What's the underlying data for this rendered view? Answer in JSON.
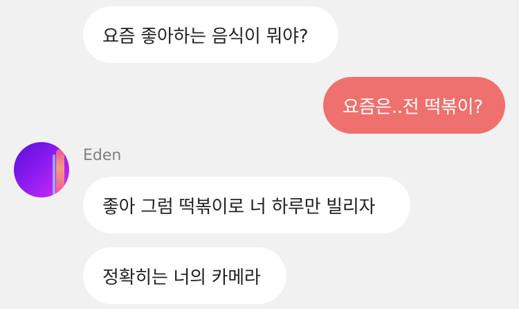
{
  "messages": [
    {
      "direction": "incoming",
      "text": "요즘 좋아하는 음식이 뭐야?"
    },
    {
      "direction": "outgoing",
      "text": "요즘은..전 떡볶이?"
    },
    {
      "direction": "incoming",
      "text": "좋아 그럼 떡볶이로 너 하루만 빌리자"
    },
    {
      "direction": "incoming",
      "text": "정확히는 너의 카메라"
    }
  ],
  "contact": {
    "name": "Eden",
    "avatar_icon": "profile-photo"
  },
  "colors": {
    "background": "#f1f1f1",
    "incoming_bubble": "#ffffff",
    "outgoing_bubble": "#ef716e",
    "sender_name": "#808080"
  }
}
